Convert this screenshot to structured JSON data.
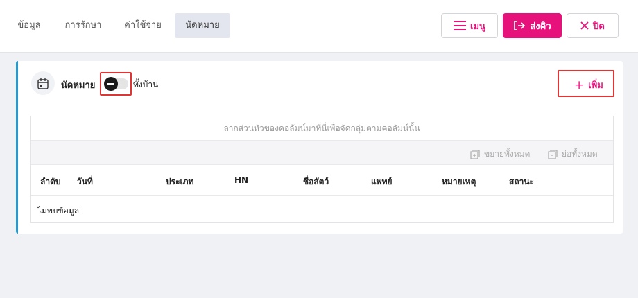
{
  "tabs": [
    {
      "label": "ข้อมูล",
      "active": false
    },
    {
      "label": "การรักษา",
      "active": false
    },
    {
      "label": "ค่าใช้จ่าย",
      "active": false
    },
    {
      "label": "นัดหมาย",
      "active": true
    }
  ],
  "actions": {
    "menu_label": "เมนู",
    "send_label": "ส่งคิว",
    "close_label": "ปิด"
  },
  "panel": {
    "title": "นัดหมาย",
    "toggle_label": "ทั้งบ้าน",
    "add_label": "เพิ่ม"
  },
  "grid": {
    "group_hint": "ลากส่วนหัวของคอลัมน์มาที่นี่เพื่อจัดกลุ่มตามคอลัมน์นั้น",
    "expand_all": "ขยายทั้งหมด",
    "collapse_all": "ย่อทั้งหมด",
    "columns": [
      "ลำดับ",
      "วันที่",
      "ประเภท",
      "HN",
      "ชื่อสัตว์",
      "แพทย์",
      "หมายเหตุ",
      "สถานะ"
    ],
    "empty_text": "ไม่พบข้อมูล"
  },
  "colors": {
    "accent": "#e6117a",
    "panel_border": "#1e9cd7",
    "highlight": "#e03535"
  }
}
